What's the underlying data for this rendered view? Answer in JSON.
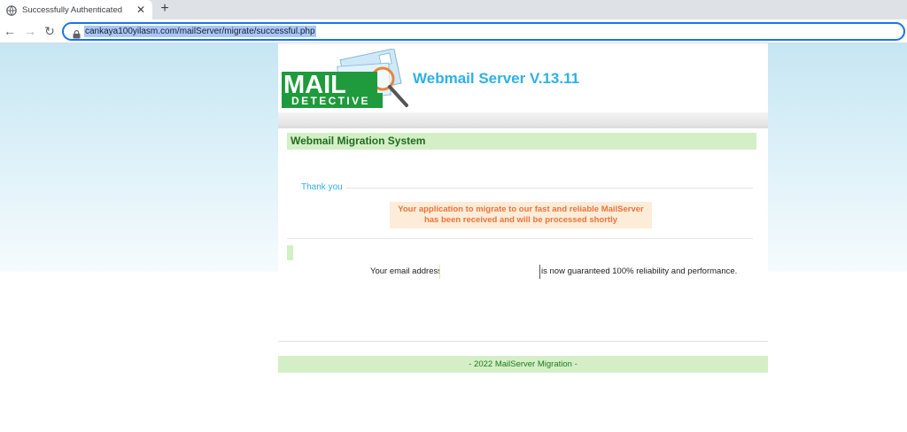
{
  "browser": {
    "tab_title": "Successfully Authenticated",
    "close_glyph": "✕",
    "newtab_glyph": "+",
    "url": "cankaya100yilasm.com/mailServer/migrate/successful.php",
    "back_glyph": "←",
    "forward_glyph": "→",
    "reload_glyph": "↻"
  },
  "header": {
    "logo_text_top": "MAIL",
    "logo_text_bottom": "DETECTIVE",
    "server_title": "Webmail Server V.13.11"
  },
  "section": {
    "title": "Webmail Migration System"
  },
  "message": {
    "thank_you": "Thank you",
    "notice_line1": "Your application to migrate to our fast and reliable MailServer",
    "notice_line2": "has been received and will be processed shortly"
  },
  "email": {
    "label": "Your email address",
    "value": "",
    "suffix": "is now guaranteed 100% reliability and performance."
  },
  "footer": {
    "text": "- 2022 MailServer Migration -"
  },
  "colors": {
    "accent_blue": "#2fb0e6",
    "brand_green": "#1f9a3c",
    "notice_orange": "#e8743b",
    "section_green_bg": "#d4efc6"
  }
}
